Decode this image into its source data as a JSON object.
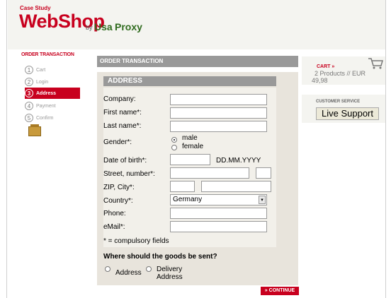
{
  "brand": {
    "case_study": "Case Study",
    "webshop": "WebShop",
    "by": "by",
    "usa": "Usa",
    "proxy": "Proxy"
  },
  "sidebar": {
    "title": "ORDER TRANSACTION",
    "steps": [
      {
        "num": "1",
        "label": "Cart"
      },
      {
        "num": "2",
        "label": "Login"
      },
      {
        "num": "3",
        "label": "Address"
      },
      {
        "num": "4",
        "label": "Payment"
      },
      {
        "num": "5",
        "label": "Confirm"
      }
    ]
  },
  "main": {
    "header": "ORDER TRANSACTION",
    "address_header": "ADDRESS",
    "fields": {
      "company": {
        "label": "Company:",
        "value": ""
      },
      "first_name": {
        "label": "First name*:",
        "value": ""
      },
      "last_name": {
        "label": "Last name*:",
        "value": ""
      },
      "gender": {
        "label": "Gender*:",
        "options": [
          "male",
          "female"
        ],
        "selected": "male"
      },
      "dob": {
        "label": "Date of birth*:",
        "format": "DD.MM.YYYY"
      },
      "street": {
        "label": "Street, number*:"
      },
      "zip_city": {
        "label": "ZIP, City*:"
      },
      "country": {
        "label": "Country*:",
        "value": "Germany"
      },
      "phone": {
        "label": "Phone:"
      },
      "email": {
        "label": "eMail*:"
      }
    },
    "compulsory_note": "* = compulsory fields",
    "goods": {
      "question": "Where should the goods be sent?",
      "opt1": "Address",
      "opt2_line1": "Delivery",
      "opt2_line2": "Address"
    },
    "continue_label": "» CONTINUE"
  },
  "cart": {
    "title": "CART »",
    "line1": "2 Products // EUR",
    "line2": "49,98"
  },
  "service": {
    "title": "CUSTOMER SERVICE",
    "button": "Live Support"
  },
  "colors": {
    "brand_red": "#c8001e",
    "brand_green": "#2f6b1e",
    "panel": "#e8e4dc"
  }
}
